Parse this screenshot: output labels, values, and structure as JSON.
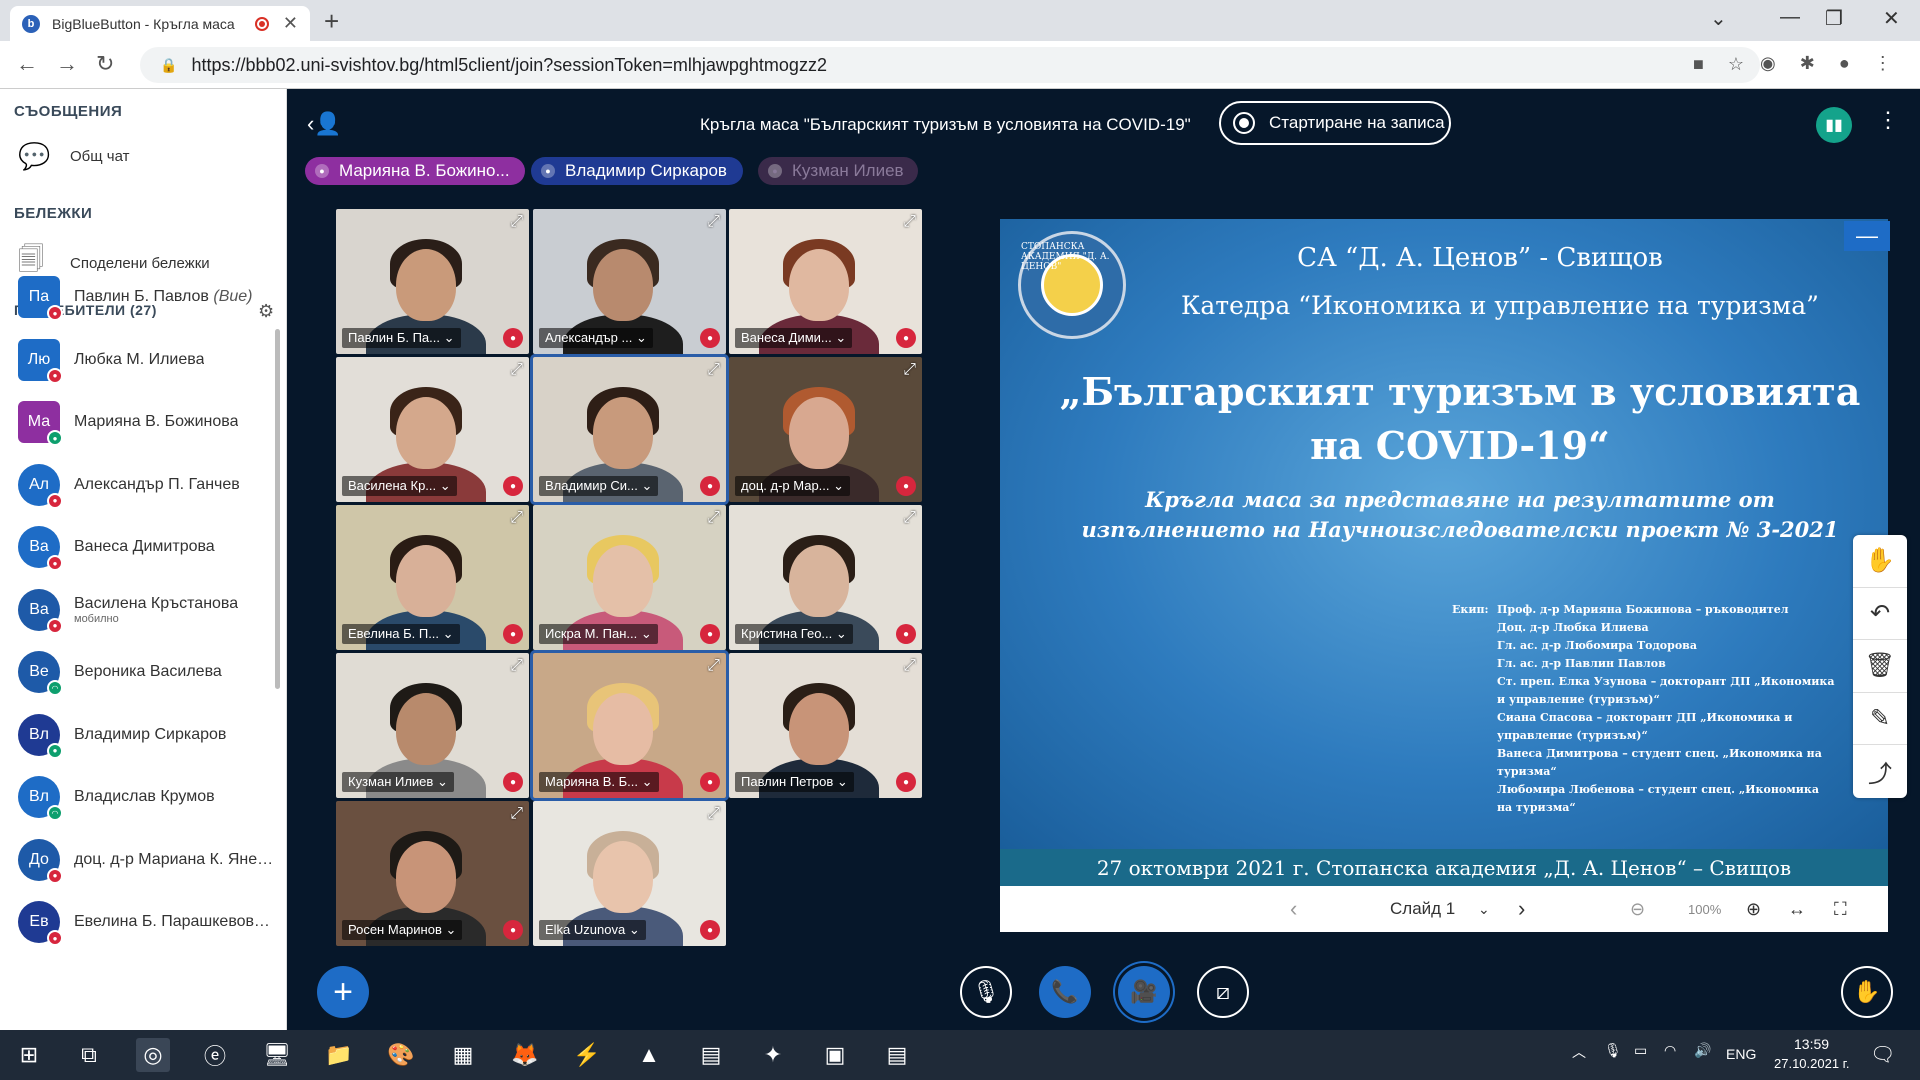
{
  "browser": {
    "tab_title": "BigBlueButton - Кръгла маса",
    "favicon_letter": "b",
    "new_tab": "+",
    "url": "https://bbb02.uni-svishtov.bg/html5client/join?sessionToken=mlhjawpghtmogzz2"
  },
  "sidebar": {
    "messages_header": "СЪОБЩЕНИЯ",
    "public_chat": "Общ чат",
    "notes_header": "БЕЛЕЖКИ",
    "shared_notes": "Споделени бележки",
    "users_header": "ПОТРЕБИТЕЛИ (27)",
    "users": [
      {
        "initials": "Па",
        "name": "Павлин Б. Павлов",
        "suffix": "(Вие)",
        "sub": "",
        "color": "#1E6CC6",
        "shape": "square",
        "mic": "muted"
      },
      {
        "initials": "Лю",
        "name": "Любка М. Илиева",
        "suffix": "",
        "sub": "",
        "color": "#1E6CC6",
        "shape": "square",
        "mic": "muted"
      },
      {
        "initials": "Ма",
        "name": "Марияна В. Божинова",
        "suffix": "",
        "sub": "",
        "color": "#8E2FA0",
        "shape": "square",
        "mic": "on"
      },
      {
        "initials": "Ал",
        "name": "Александър П. Ганчев",
        "suffix": "",
        "sub": "",
        "color": "#1E6CC6",
        "shape": "round",
        "mic": "muted"
      },
      {
        "initials": "Ва",
        "name": "Ванеса Димитрова",
        "suffix": "",
        "sub": "",
        "color": "#1E6CC6",
        "shape": "round",
        "mic": "muted"
      },
      {
        "initials": "Ва",
        "name": "Василена Кръстанова",
        "suffix": "",
        "sub": "мобилно",
        "color": "#1E5AA8",
        "shape": "round",
        "mic": "muted"
      },
      {
        "initials": "Ве",
        "name": "Вероника Василева",
        "suffix": "",
        "sub": "",
        "color": "#1E5AA8",
        "shape": "round",
        "mic": "listen"
      },
      {
        "initials": "Вл",
        "name": "Владимир Сиркаров",
        "suffix": "",
        "sub": "",
        "color": "#1F3A93",
        "shape": "round",
        "mic": "on"
      },
      {
        "initials": "Вл",
        "name": "Владислав Крумов",
        "suffix": "",
        "sub": "",
        "color": "#1E6CC6",
        "shape": "round",
        "mic": "listen"
      },
      {
        "initials": "До",
        "name": "доц. д-р Мариана К. Янева",
        "suffix": "",
        "sub": "",
        "color": "#1E5AA8",
        "shape": "round",
        "mic": "muted"
      },
      {
        "initials": "Ев",
        "name": "Евелина Б. Парашкевова...",
        "suffix": "",
        "sub": "",
        "color": "#1F3A93",
        "shape": "round",
        "mic": "muted"
      }
    ]
  },
  "meeting": {
    "title": "Кръгла маса \"Българският туризъм в условията на COVID-19\"",
    "record_label": "Стартиране на записа",
    "talkers": [
      {
        "name": "Марияна В. Божино...",
        "color": "#8E2FA0"
      },
      {
        "name": "Владимир Сиркаров",
        "color": "#1F3A93"
      },
      {
        "name": "Кузман Илиев",
        "color": "#3A2A4A"
      }
    ]
  },
  "videos": [
    {
      "name": "Павлин Б. Па...",
      "bg": "#D9D5CF",
      "skin": "#C99A7A",
      "hair": "#2A1E18",
      "shirt": "#2B3A4A"
    },
    {
      "name": "Александър ...",
      "bg": "#C9CDD2",
      "skin": "#B88A6E",
      "hair": "#3A2A20",
      "shirt": "#1E1E1E"
    },
    {
      "name": "Ванеса Дими...",
      "bg": "#E8E2DA",
      "skin": "#E0B8A0",
      "hair": "#7A3A22",
      "shirt": "#6A2A3A"
    },
    {
      "name": "Василена Кр...",
      "bg": "#E2DED8",
      "skin": "#D4A88C",
      "hair": "#3A2418",
      "shirt": "#8A3A3A"
    },
    {
      "name": "Владимир Си...",
      "bg": "#D8D2C8",
      "skin": "#C89A7C",
      "hair": "#2E1E16",
      "shirt": "#5A6470"
    },
    {
      "name": "доц. д-р Мар...",
      "bg": "#5A4A3A",
      "skin": "#D8A890",
      "hair": "#B05A30",
      "shirt": "#3A2A2A"
    },
    {
      "name": "Евелина Б. П...",
      "bg": "#CFC6A8",
      "skin": "#D8B098",
      "hair": "#2A1C14",
      "shirt": "#2A4A6A"
    },
    {
      "name": "Искра М. Пан...",
      "bg": "#D6D2C2",
      "skin": "#E4C0A8",
      "hair": "#E8C860",
      "shirt": "#C85A7A"
    },
    {
      "name": "Кристина Гео...",
      "bg": "#E4E0D8",
      "skin": "#D8B49C",
      "hair": "#2A1E16",
      "shirt": "#3A4A5A"
    },
    {
      "name": "Кузман Илиев",
      "bg": "#E0DCD4",
      "skin": "#B88A6C",
      "hair": "#1E1A16",
      "shirt": "#8A8A8A"
    },
    {
      "name": "Марияна В. Б...",
      "bg": "#C8A888",
      "skin": "#E6BCA4",
      "hair": "#E8C478",
      "shirt": "#C83A4A"
    },
    {
      "name": "Павлин Петров",
      "bg": "#E4DED6",
      "skin": "#C89478",
      "hair": "#2A1E16",
      "shirt": "#1E2A3A"
    },
    {
      "name": "Росен Маринов",
      "bg": "#6A5040",
      "skin": "#C89478",
      "hair": "#1E1A16",
      "shirt": "#2A2A2A"
    },
    {
      "name": "Elka Uzunova",
      "bg": "#E8E6E0",
      "skin": "#E8C4AC",
      "hair": "#C8B098",
      "shirt": "#4A5A7A"
    }
  ],
  "slide": {
    "seal_text": "СТОПАНСКА АКАДЕМИЯ \"Д. А. ЦЕНОВ\"",
    "line1": "СА “Д. А. Ценов” - Свищов",
    "line2": "Катедра “Икономика и управление на туризма”",
    "title1": "„Българският туризъм в условията",
    "title2": "на COVID-19“",
    "sub1": "Кръгла маса за представяне на резултатите от",
    "sub2": "изпълнението на Научноизследователски проект № 3-2021",
    "team_label": "Екип:",
    "team": [
      "Проф. д-р Марияна Божинова – ръководител",
      "Доц. д-р Любка Илиева",
      "Гл. ас. д-р Любомира Тодорова",
      "Гл. ас. д-р Павлин Павлов",
      "Ст. преп. Елка Узунова – докторант ДП „Икономика и управление (туризъм)“",
      "Сиана Спасова – докторант ДП „Икономика и управление (туризъм)“",
      "Ванеса Димитрова – студент спец. „Икономика на туризма“",
      "Любомира Любенова – студент спец. „Икономика на туризма“"
    ],
    "footer": "27 октомври 2021 г. Стопанска академия „Д. А. Ценов“ – Свищов"
  },
  "slide_controls": {
    "slide_label": "Слайд 1",
    "zoom": "100%"
  },
  "taskbar": {
    "lang": "ENG",
    "time": "13:59",
    "date": "27.10.2021 г."
  }
}
